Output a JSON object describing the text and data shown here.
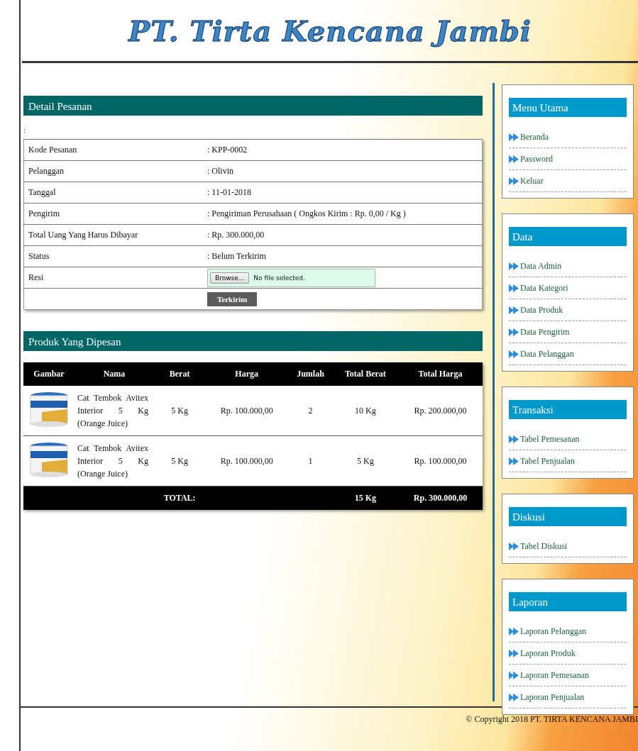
{
  "header": {
    "logo": "PT. Tirta Kencana Jambi"
  },
  "detail": {
    "title": "Detail Pesanan",
    "note": ":",
    "rows": [
      {
        "label": "Kode Pesanan",
        "value": ": KPP-0002"
      },
      {
        "label": "Pelanggan",
        "value": ": Olivin"
      },
      {
        "label": "Tanggal",
        "value": ": 11-01-2018"
      },
      {
        "label": "Pengirim",
        "value": ": Pengiriman Perusahaan ( Ongkos Kirim : Rp. 0,00 / Kg )"
      },
      {
        "label": "Total Uang Yang Harus Dibayar",
        "value": ": Rp. 300.000,00"
      },
      {
        "label": "Status",
        "value": ": Belum Terkirim"
      }
    ],
    "resi": {
      "label": "Resi",
      "button": "Browse...",
      "file_status": "No file selected."
    },
    "submit": "Terkirim"
  },
  "products": {
    "title": "Produk Yang Dipesan",
    "columns": [
      "Gambar",
      "Nama",
      "Berat",
      "Harga",
      "Jumlah",
      "Total Berat",
      "Total Harga"
    ],
    "rows": [
      {
        "name": "Cat Tembok Avitex Interior 5 Kg (Orange Juice)",
        "weight": "5 Kg",
        "price": "Rp. 100.000,00",
        "qty": "2",
        "total_weight": "10 Kg",
        "total_price": "Rp. 200.000,00"
      },
      {
        "name": "Cat Tembok Avitex Interior 5 Kg (Orange Juice)",
        "weight": "5 Kg",
        "price": "Rp. 100.000,00",
        "qty": "1",
        "total_weight": "5 Kg",
        "total_price": "Rp. 100.000,00"
      }
    ],
    "total": {
      "label": "TOTAL:",
      "weight": "15 Kg",
      "price": "Rp. 300.000,00"
    }
  },
  "sidebar": [
    {
      "title": "Menu Utama",
      "items": [
        "Beranda",
        "Password",
        "Keluar"
      ]
    },
    {
      "title": "Data",
      "items": [
        "Data Admin",
        "Data Kategori",
        "Data Produk",
        "Data Pengirim",
        "Data Pelanggan"
      ]
    },
    {
      "title": "Transaksi",
      "items": [
        "Tabel Pemesanan",
        "Tabel Penjualan"
      ]
    },
    {
      "title": "Diskusi",
      "items": [
        "Tabel Diskusi"
      ]
    },
    {
      "title": "Laporan",
      "items": [
        "Laporan Pelanggan",
        "Laporan Produk",
        "Laporan Pemesanan",
        "Laporan Penjualan"
      ]
    }
  ],
  "footer": "© Copyright 2018 PT. TIRTA KENCANA JAMBI"
}
